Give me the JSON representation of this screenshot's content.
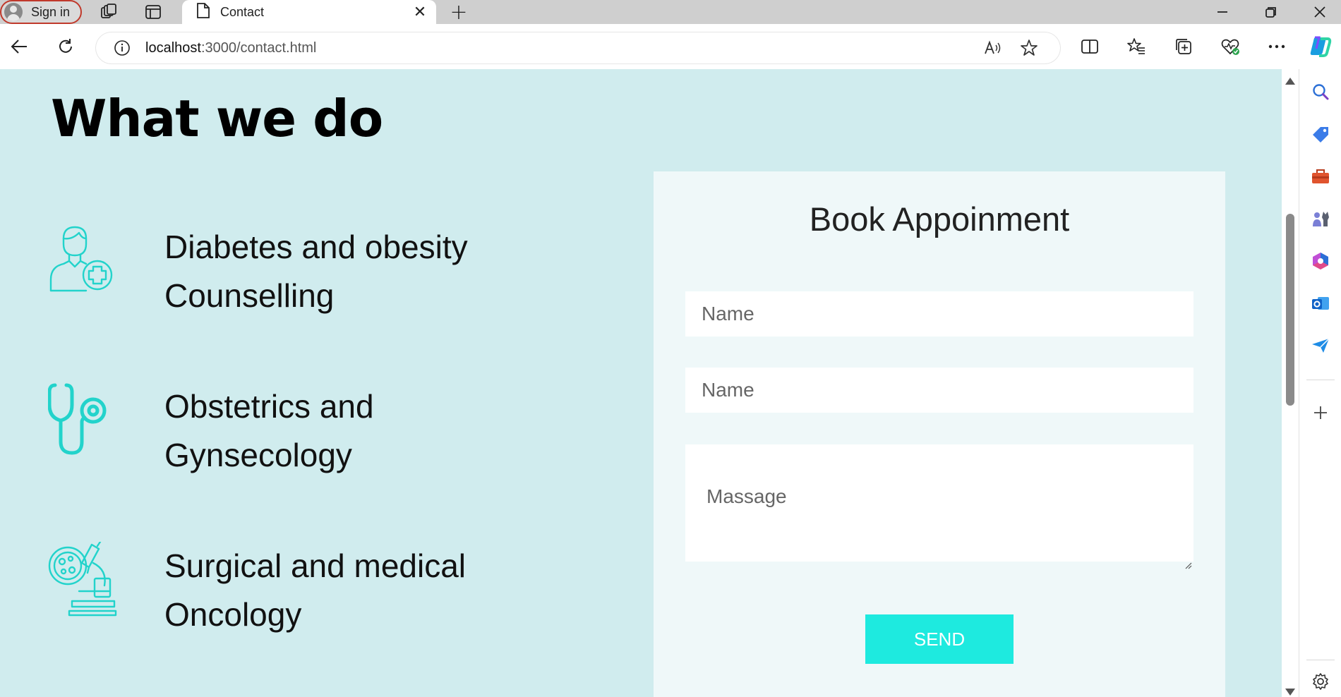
{
  "browser": {
    "sign_in_label": "Sign in",
    "tab_title": "Contact",
    "url_host": "localhost",
    "url_path": ":3000/contact.html"
  },
  "page": {
    "heading": "What we do",
    "services": [
      {
        "line1": "Diabetes and obesity",
        "line2": "Counselling",
        "icon": "doctor-plus-icon"
      },
      {
        "line1": "Obstetrics and",
        "line2": "Gynsecology",
        "icon": "stethoscope-icon"
      },
      {
        "line1": "Surgical and medical",
        "line2": "Oncology",
        "icon": "microscope-icon"
      }
    ],
    "form": {
      "title": "Book Appoinment",
      "name_placeholder": "Name",
      "name2_placeholder": "Name",
      "message_placeholder": "Massage",
      "send_label": "SEND"
    }
  },
  "colors": {
    "page_bg": "#d0ecee",
    "card_bg": "#eff8f9",
    "accent": "#1eeadf",
    "icon_stroke": "#22d3cb"
  }
}
